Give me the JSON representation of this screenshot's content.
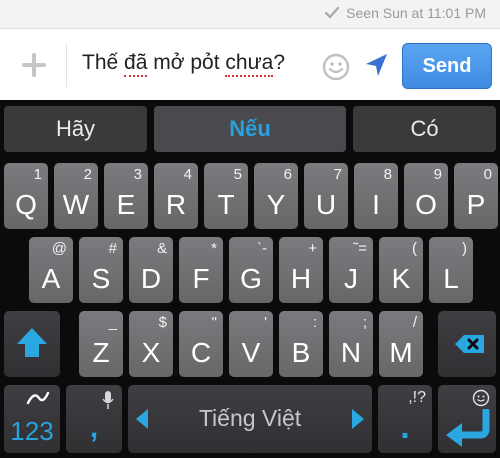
{
  "status": {
    "seen": "Seen Sun at 11:01 PM"
  },
  "compose": {
    "words": [
      {
        "text": "Thế",
        "err": false
      },
      {
        "text": "đã",
        "err": true
      },
      {
        "text": "mở",
        "err": false
      },
      {
        "text": "pỏt",
        "err": false
      },
      {
        "text": "chưa",
        "err": true
      },
      {
        "text": "?",
        "err": false
      }
    ],
    "send_label": "Send"
  },
  "suggestions": [
    "Hãy",
    "Nếu",
    "Có"
  ],
  "rows": [
    [
      {
        "m": "Q",
        "h": "1"
      },
      {
        "m": "W",
        "h": "2"
      },
      {
        "m": "E",
        "h": "3"
      },
      {
        "m": "R",
        "h": "4"
      },
      {
        "m": "T",
        "h": "5"
      },
      {
        "m": "Y",
        "h": "6"
      },
      {
        "m": "U",
        "h": "7"
      },
      {
        "m": "I",
        "h": "8"
      },
      {
        "m": "O",
        "h": "9"
      },
      {
        "m": "P",
        "h": "0"
      }
    ],
    [
      {
        "m": "A",
        "h": "@"
      },
      {
        "m": "S",
        "h": "#"
      },
      {
        "m": "D",
        "h": "&"
      },
      {
        "m": "F",
        "h": "*"
      },
      {
        "m": "G",
        "h": "`-"
      },
      {
        "m": "H",
        "h": "+"
      },
      {
        "m": "J",
        "h": "˜="
      },
      {
        "m": "K",
        "h": "("
      },
      {
        "m": "L",
        "h": ")"
      }
    ],
    [
      {
        "m": "Z",
        "h": "_"
      },
      {
        "m": "X",
        "h": "$"
      },
      {
        "m": "C",
        "h": "\""
      },
      {
        "m": "V",
        "h": "'"
      },
      {
        "m": "B",
        "h": ":"
      },
      {
        "m": "N",
        "h": ";"
      },
      {
        "m": "M",
        "h": "/"
      }
    ]
  ],
  "bottom": {
    "numbers": "123",
    "comma": ",",
    "space_label": "Tiếng Việt",
    "period": ".",
    "punct_hint": ",!?"
  },
  "colors": {
    "accent": "#27a2dd",
    "send": "#4b95e8",
    "error_underline": "#d63232"
  }
}
